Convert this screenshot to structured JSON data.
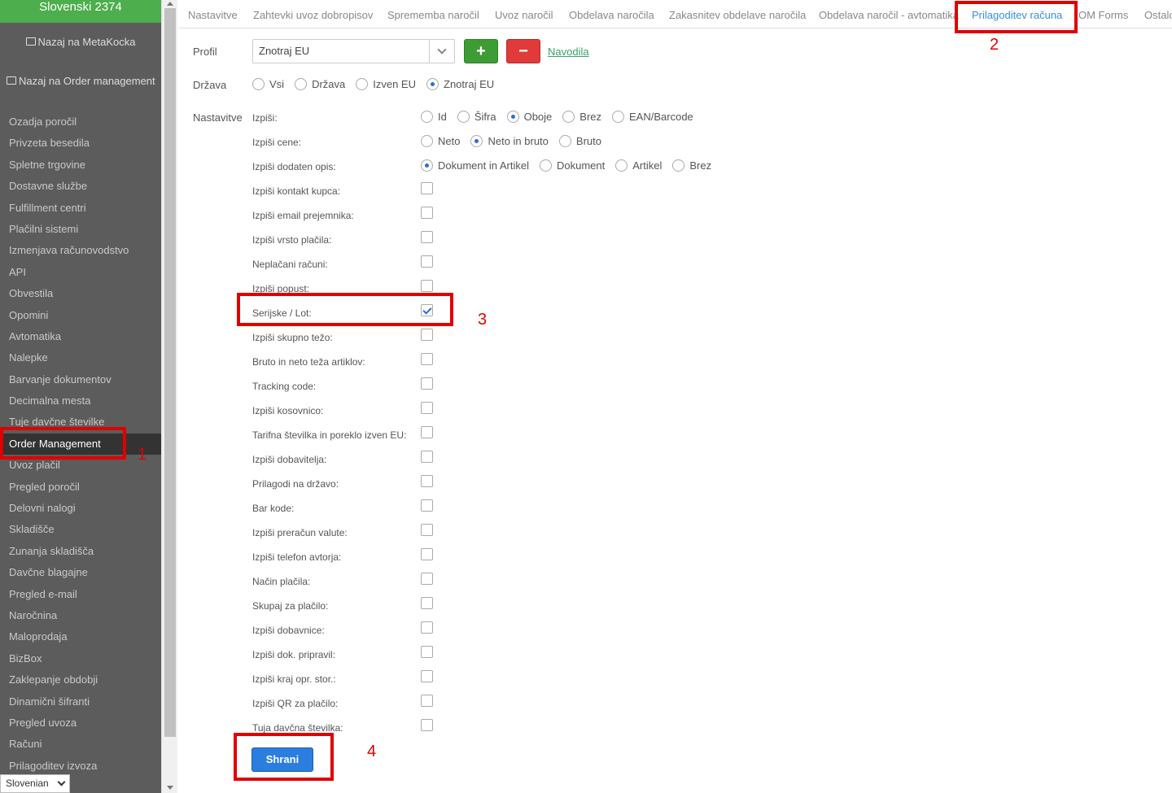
{
  "sidebar": {
    "header": "Slovenski 2374",
    "back_metakocka": "Nazaj na MetaKocka",
    "back_order_management": "Nazaj na Order management",
    "items": [
      "Ozadja poročil",
      "Privzeta besedila",
      "Spletne trgovine",
      "Dostavne službe",
      "Fulfillment centri",
      "Plačilni sistemi",
      "Izmenjava računovodstvo",
      "API",
      "Obvestila",
      "Opomini",
      "Avtomatika",
      "Nalepke",
      "Barvanje dokumentov",
      "Decimalna mesta",
      "Tuje davčne številke",
      "Order Management",
      "Uvoz plačil",
      "Pregled poročil",
      "Delovni nalogi",
      "Skladišče",
      "Zunanja skladišča",
      "Davčne blagajne",
      "Pregled e-mail",
      "Naročnina",
      "Maloprodaja",
      "BizBox",
      "Zaklepanje obdobji",
      "Dinamični šifranti",
      "Pregled uvoza",
      "Računi",
      "Prilagoditev izvoza"
    ],
    "active_item": "Order Management",
    "language": "Slovenian"
  },
  "tabs": [
    "Nastavitve",
    "Zahtevki uvoz dobropisov",
    "Sprememba naročil",
    "Uvoz naročil",
    "Obdelava naročila",
    "Zakasnitev obdelave naročila",
    "Obdelava naročil - avtomatika",
    "Prilagoditev računa",
    "OM Forms",
    "Ostalo"
  ],
  "active_tab": "Prilagoditev računa",
  "form": {
    "profil_label": "Profil",
    "profil_value": "Znotraj EU",
    "add_label": "+",
    "delete_label": "−",
    "help_link": "Navodila",
    "drzava_label": "Država",
    "drzava_options": [
      "Vsi",
      "Država",
      "Izven EU",
      "Znotraj EU"
    ],
    "drzava_selected": "Znotraj EU",
    "nastavitve_label": "Nastavitve",
    "izpisi_label": "Izpiši:",
    "izpisi_options": [
      "Id",
      "Šifra",
      "Oboje",
      "Brez",
      "EAN/Barcode"
    ],
    "izpisi_selected": "Oboje",
    "cene_label": "Izpiši cene:",
    "cene_options": [
      "Neto",
      "Neto in bruto",
      "Bruto"
    ],
    "cene_selected": "Neto in bruto",
    "opis_label": "Izpiši dodaten opis:",
    "opis_options": [
      "Dokument in Artikel",
      "Dokument",
      "Artikel",
      "Brez"
    ],
    "opis_selected": "Dokument in Artikel",
    "checkboxes": [
      {
        "label": "Izpiši kontakt kupca:",
        "checked": false
      },
      {
        "label": "Izpiši email prejemnika:",
        "checked": false
      },
      {
        "label": "Izpiši vrsto plačila:",
        "checked": false
      },
      {
        "label": "Neplačani računi:",
        "checked": false
      },
      {
        "label": "Izpiši popust:",
        "checked": false
      },
      {
        "label": "Serijske / Lot:",
        "checked": true
      },
      {
        "label": "Izpiši skupno težo:",
        "checked": false
      },
      {
        "label": "Bruto in neto teža artiklov:",
        "checked": false
      },
      {
        "label": "Tracking code:",
        "checked": false
      },
      {
        "label": "Izpiši kosovnico:",
        "checked": false
      },
      {
        "label": "Tarifna številka in poreklo izven EU:",
        "checked": false
      },
      {
        "label": "Izpiši dobavitelja:",
        "checked": false
      },
      {
        "label": "Prilagodi na državo:",
        "checked": false
      },
      {
        "label": "Bar kode:",
        "checked": false
      },
      {
        "label": "Izpiši preračun valute:",
        "checked": false
      },
      {
        "label": "Izpiši telefon avtorja:",
        "checked": false
      },
      {
        "label": "Način plačila:",
        "checked": false
      },
      {
        "label": "Skupaj za plačilo:",
        "checked": false
      },
      {
        "label": "Izpiši dobavnice:",
        "checked": false
      },
      {
        "label": "Izpiši dok. pripravil:",
        "checked": false
      },
      {
        "label": "Izpiši kraj opr. stor.:",
        "checked": false
      },
      {
        "label": "Izpiši QR za plačilo:",
        "checked": false
      },
      {
        "label": "Tuja davčna številka:",
        "checked": false
      }
    ],
    "save_label": "Shrani"
  },
  "annotations": [
    "1",
    "2",
    "3",
    "4"
  ],
  "colors": {
    "annotation": "#e00000",
    "sidebar_bg": "#5c5c5c",
    "sidebar_header": "#4cae4c",
    "primary": "#2b7de0",
    "add": "#3d9c33",
    "delete": "#e03a3a",
    "active_tab": "#3a8dde"
  }
}
